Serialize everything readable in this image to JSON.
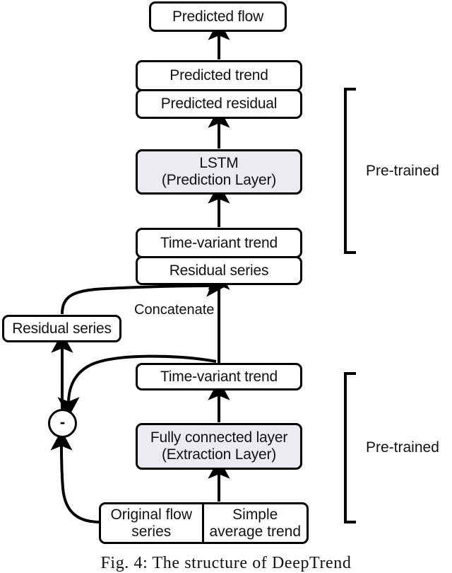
{
  "figure": {
    "caption": "Fig. 4: The structure of DeepTrend"
  },
  "nodes": {
    "predicted_flow": "Predicted flow",
    "predicted_trend": "Predicted trend",
    "predicted_residual": "Predicted residual",
    "lstm_line1": "LSTM",
    "lstm_line2": "(Prediction Layer)",
    "time_variant_trend_upper": "Time-variant trend",
    "residual_series_upper": "Residual series",
    "residual_series_left": "Residual series",
    "time_variant_trend_lower": "Time-variant trend",
    "fc_line1": "Fully connected layer",
    "fc_line2": "(Extraction Layer)",
    "original_flow_series": "Original flow series",
    "simple_average_trend": "Simple average trend",
    "minus_operator": "-"
  },
  "labels": {
    "concatenate": "Concatenate",
    "pretrained_top": "Pre-trained",
    "pretrained_bottom": "Pre-trained"
  },
  "colors": {
    "stroke": "#000000",
    "box_fill": "#ffffff",
    "shaded_fill": "#ecebf1",
    "text": "#111111"
  }
}
